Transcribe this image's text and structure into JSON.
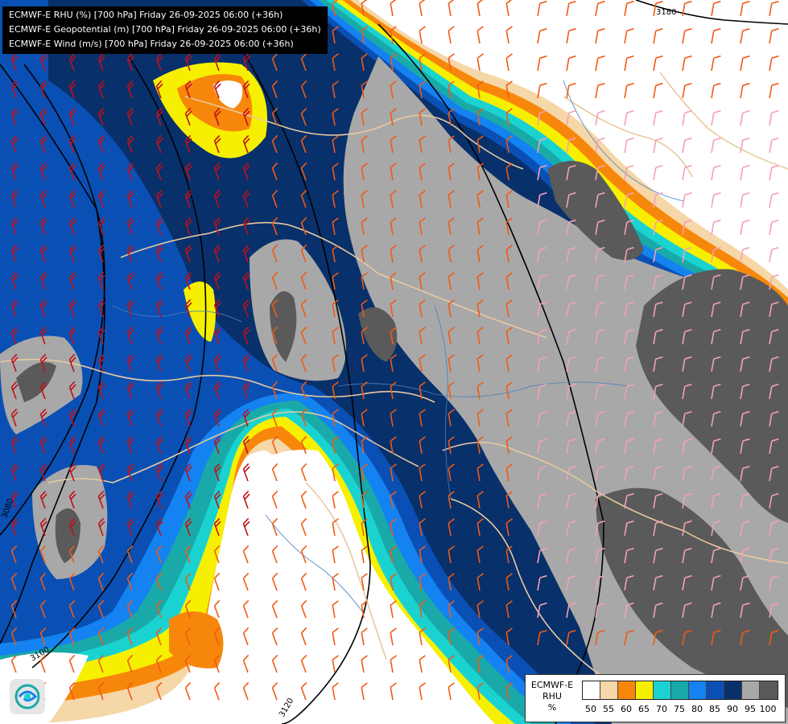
{
  "header": {
    "lines": [
      "ECMWF-E RHU (%) [700 hPa] Friday 26-09-2025 06:00 (+36h)",
      "ECMWF-E Geopotential (m) [700 hPa] Friday 26-09-2025 06:00 (+36h)",
      "ECMWF-E Wind (m/s) [700 hPa] Friday 26-09-2025 06:00 (+36h)"
    ]
  },
  "legend": {
    "title_lines": [
      "ECMWF-E",
      "RHU",
      "%"
    ],
    "ticks": [
      "50",
      "55",
      "60",
      "65",
      "70",
      "75",
      "80",
      "85",
      "90",
      "95",
      "100"
    ],
    "colors": [
      "#ffffff",
      "#f5d7a8",
      "#f7870a",
      "#f6f000",
      "#1ad3d1",
      "#1aa9a9",
      "#1482f0",
      "#0a50b4",
      "#08306b",
      "#a8a8a8",
      "#5a5a5a"
    ]
  },
  "contours": {
    "labels": [
      "3180",
      "3100",
      "3120",
      "3080"
    ]
  },
  "map": {
    "colors": {
      "background": "#ffffff",
      "rh_50": "#f5d7a8",
      "rh_60": "#f7870a",
      "rh_65": "#f6f000",
      "rh_70": "#1ad3d1",
      "rh_75": "#1aa9a9",
      "rh_80": "#1482f0",
      "rh_85": "#0a50b4",
      "rh_90": "#08306b",
      "rh_95": "#a8a8a8",
      "rh_100": "#5a5a5a",
      "border": "#e8c9a0",
      "river": "#4a7fc0",
      "barb_strong": "#c0101a",
      "barb_mid": "#f05a14",
      "barb_weak": "#f4a0b8"
    }
  },
  "logo": {
    "icon": "ecmwf-swirl-icon"
  }
}
